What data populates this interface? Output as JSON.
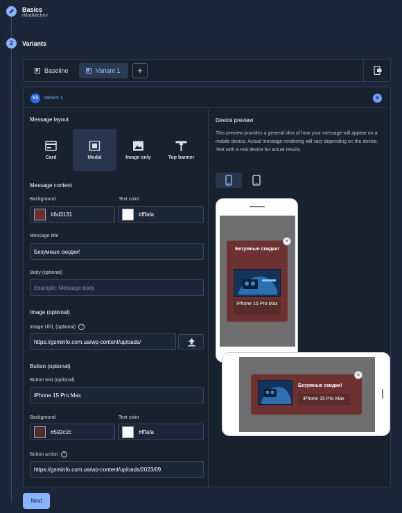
{
  "steps": {
    "basics": {
      "title": "Basics",
      "subtitle": "rkhaikitchev"
    },
    "variants": {
      "number": "2",
      "title": "Variants"
    }
  },
  "tabs": [
    {
      "label": "Baseline",
      "active": false
    },
    {
      "label": "Variant 1",
      "active": true
    }
  ],
  "add_tab_label": "+",
  "variant_panel": {
    "badge": "V1",
    "label": "Variant 1",
    "close_glyph": "×"
  },
  "message_layout": {
    "title": "Message layout",
    "options": [
      {
        "label": "Card",
        "icon": "card-icon",
        "selected": false
      },
      {
        "label": "Modal",
        "icon": "modal-icon",
        "selected": true
      },
      {
        "label": "Image only",
        "icon": "image-icon",
        "selected": false
      },
      {
        "label": "Top banner",
        "icon": "top-banner-icon",
        "selected": false
      }
    ]
  },
  "message_content": {
    "title": "Message content",
    "background_label": "Background",
    "background_value": "#6d3131",
    "text_color_label": "Text color",
    "text_color_value": "#fffafa",
    "message_title_label": "Message title",
    "message_title_value": "Безумные скидки!",
    "body_label": "Body (optional)",
    "body_placeholder": "Example: Message body"
  },
  "image": {
    "title": "Image (optional)",
    "url_label": "Image URL (optional)",
    "url_value": "https://gsminfo.com.ua/wp-content/uploads/"
  },
  "button": {
    "title": "Button (optional)",
    "text_label": "Button text (optional)",
    "text_value": "iPhone 15 Pro Max",
    "background_label": "Background",
    "background_value": "#592c2c",
    "text_color_label": "Text color",
    "text_color_value": "#fffafa",
    "action_label": "Button action",
    "action_value": "https://gsminfo.com.ua/wp-content/uploads/2023/09"
  },
  "device_preview": {
    "title": "Device preview",
    "description": "This preview provides a general idea of how your message will appear on a mobile device. Actual message rendering will vary depending on the device. Test with a real device for actual results.",
    "portrait_selected": true
  },
  "preview": {
    "portrait_title": "Безумные скидки!",
    "landscape_title": "Безумные скидки!",
    "button_text": "iPhone 15 Pro Max",
    "close_glyph": "×"
  },
  "help_glyph": "?",
  "next_label": "Next",
  "colors": {
    "accent": "#8ab4ff",
    "modal_background": "#6d3131",
    "button_background": "#592c2c",
    "text_color": "#fffafa"
  }
}
